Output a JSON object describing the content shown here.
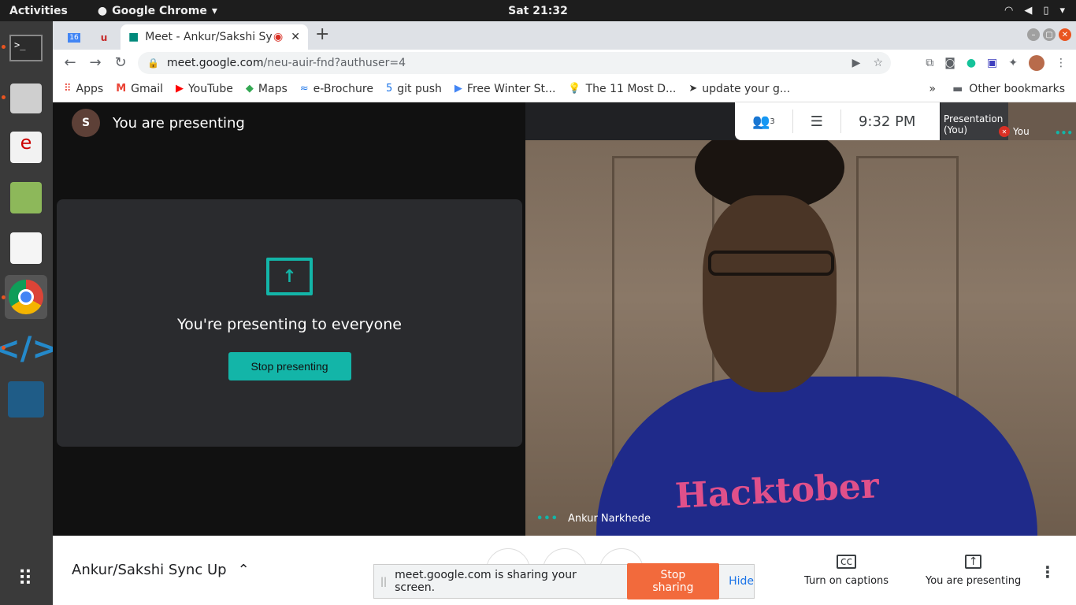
{
  "topbar": {
    "activities": "Activities",
    "app_name": "Google Chrome",
    "clock": "Sat 21:32"
  },
  "tabs": {
    "active_title": "Meet - Ankur/Sakshi Sy",
    "small_tab_1": "16"
  },
  "address_bar": {
    "host": "meet.google.com",
    "path": "/neu-auir-fnd?authuser=4"
  },
  "bookmarks": [
    {
      "label": "Apps",
      "icon": "apps-grid-icon"
    },
    {
      "label": "Gmail",
      "icon": "gmail-icon"
    },
    {
      "label": "YouTube",
      "icon": "youtube-icon"
    },
    {
      "label": "Maps",
      "icon": "maps-icon"
    },
    {
      "label": "e-Brochure",
      "icon": "brochure-icon"
    },
    {
      "label": "git push",
      "icon": "git-icon"
    },
    {
      "label": "Free Winter St...",
      "icon": "play-icon"
    },
    {
      "label": "The 11 Most D...",
      "icon": "bulb-icon"
    },
    {
      "label": "update your g...",
      "icon": "arrow-icon"
    }
  ],
  "bookmarks_other": "Other bookmarks",
  "meet": {
    "presenting_header": "You are presenting",
    "avatar_initial": "S",
    "present_message": "You're presenting to everyone",
    "stop_presenting": "Stop presenting",
    "participant_name": "Ankur Narkhede",
    "participant_count": "3",
    "time": "9:32  PM",
    "thumb_presentation": "Presentation (You)",
    "thumb_you": "You",
    "meeting_title": "Ankur/Sakshi Sync Up",
    "captions_label": "Turn on captions",
    "you_presenting_label": "You are presenting",
    "shirt_text": "Hacktober"
  },
  "share_bar": {
    "message": "meet.google.com is sharing your screen.",
    "stop_label": "Stop sharing",
    "hide_label": "Hide"
  },
  "colors": {
    "accent": "#13b5a8",
    "stop_share": "#f26a3c",
    "ubuntu_orange": "#e95420"
  }
}
